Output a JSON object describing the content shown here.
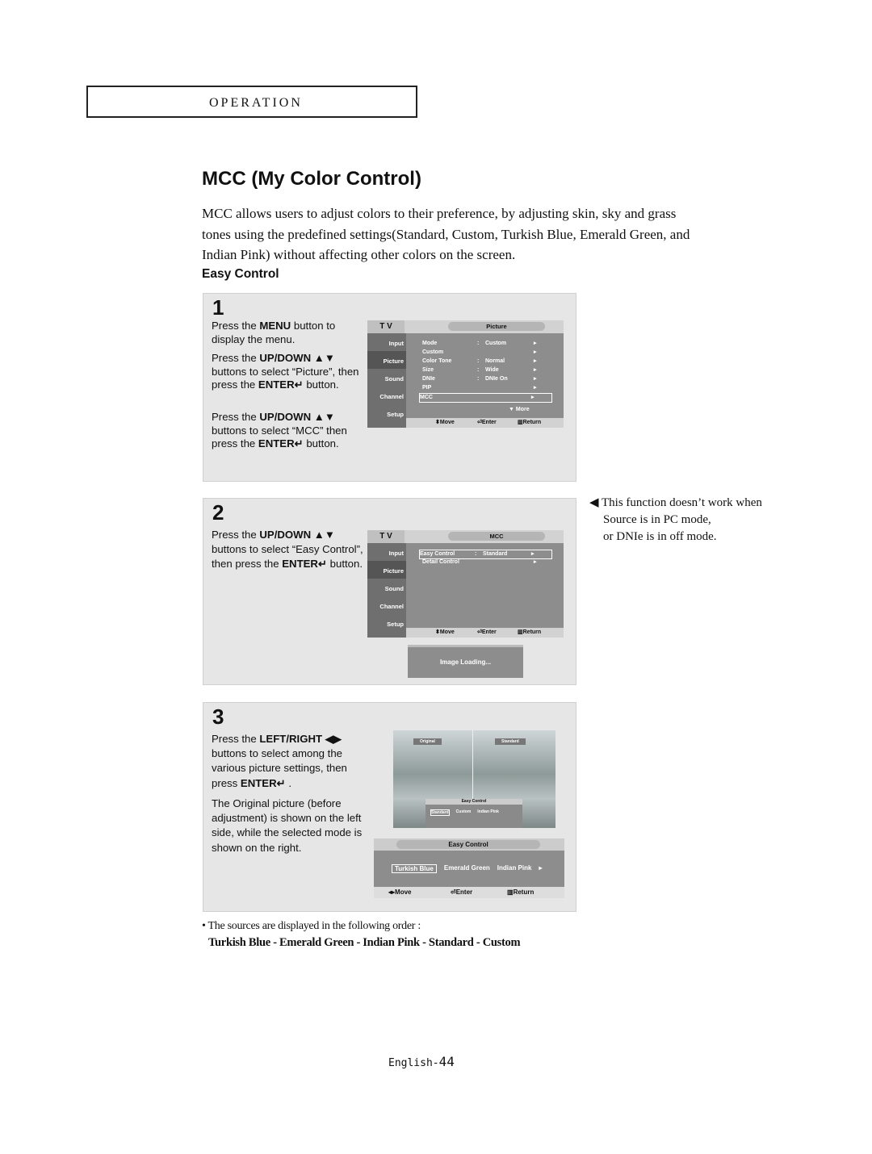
{
  "section": "OPERATION",
  "title": "MCC (My Color Control)",
  "intro": "MCC allows users to adjust colors to their preference, by adjusting skin, sky and grass tones using the predefined settings(Standard, Custom, Turkish Blue, Emerald Green, and Indian Pink) without affecting other colors on the screen.",
  "subtitle": "Easy Control",
  "osd_common": {
    "tv": "T V",
    "side": [
      "Input",
      "Picture",
      "Sound",
      "Channel",
      "Setup"
    ],
    "move": "Move",
    "enter": "Enter",
    "ret": "Return"
  },
  "step1": {
    "num": "1",
    "p1a": "Press the ",
    "p1b": "MENU",
    "p1c": " button to display the menu.",
    "p2a": "Press the ",
    "p2b": "UP/DOWN ▲▼",
    "p2c": " buttons to select “Picture”, then press the ",
    "p2d": "ENTER↵",
    "p2e": " button.",
    "p3a": "Press the ",
    "p3b": "UP/DOWN ▲▼",
    "p3c": " buttons to select “MCC” then press the ",
    "p3d": "ENTER↵",
    "p3e": " button.",
    "osd": {
      "header": "Picture",
      "rows": [
        [
          "Mode",
          ":",
          "Custom"
        ],
        [
          "Custom",
          "",
          ""
        ],
        [
          "Color Tone",
          ":",
          "Normal"
        ],
        [
          "Size",
          ":",
          "Wide"
        ],
        [
          "DNIe",
          ":",
          "DNIe On"
        ],
        [
          "PIP",
          "",
          ""
        ],
        [
          "MCC",
          "",
          ""
        ]
      ],
      "more": "More"
    }
  },
  "step2": {
    "num": "2",
    "p1a": "Press the ",
    "p1b": "UP/DOWN ▲▼",
    "p1c": "  buttons to select “Easy Control”, then press the ",
    "p1d": "ENTER↵",
    "p1e": " button.",
    "osd": {
      "header": "MCC",
      "rows": [
        [
          "Easy Control",
          ":",
          "Standard"
        ],
        [
          "Detail Control",
          "",
          ""
        ]
      ]
    },
    "loading": "Image Loading..."
  },
  "step3": {
    "num": "3",
    "p1a": "Press the ",
    "p1b": "LEFT/RIGHT ◀▶",
    "p1c": " buttons to select among the various picture settings, then press ",
    "p1d": "ENTER↵",
    "p1e": " .",
    "p2": "The Original picture (before adjustment) is shown on the left side, while the selected mode is shown on the right.",
    "photo": {
      "left": "Original",
      "right": "Standard",
      "mini_title": "Easy Control",
      "mini_opts": [
        "Standard",
        "Custom",
        "Indian Pink"
      ]
    },
    "bar": {
      "title": "Easy Control",
      "opts": [
        "Turkish Blue",
        "Emerald Green",
        "Indian Pink"
      ]
    }
  },
  "note": [
    "This function doesn’t work when",
    "Source is in PC mode,",
    "or DNIe is in off mode."
  ],
  "bullet": "• The sources are displayed in the following order :",
  "order": "Turkish Blue - Emerald Green - Indian Pink - Standard - Custom",
  "footer": {
    "lang": "English-",
    "page": "44"
  }
}
